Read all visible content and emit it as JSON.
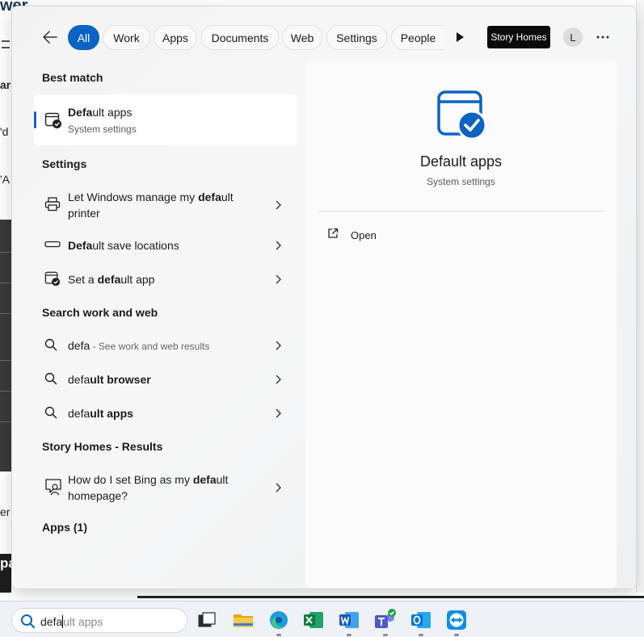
{
  "background_window": {
    "fragments": [
      "wer",
      "arc",
      "'d",
      "'A",
      "er",
      "pat"
    ]
  },
  "filters": {
    "back_label": "Back",
    "tabs": [
      {
        "label": "All",
        "active": true
      },
      {
        "label": "Work",
        "active": false
      },
      {
        "label": "Apps",
        "active": false
      },
      {
        "label": "Documents",
        "active": false
      },
      {
        "label": "Web",
        "active": false
      },
      {
        "label": "Settings",
        "active": false
      },
      {
        "label": "People",
        "active": false
      }
    ],
    "org_badge": "Story Homes",
    "avatar_initial": "L"
  },
  "results": {
    "best_match_heading": "Best match",
    "best_match": {
      "title_bold": "Defa",
      "title_rest": "ult apps",
      "subtitle": "System settings"
    },
    "settings_heading": "Settings",
    "settings_items": [
      {
        "pre": "Let Windows manage my ",
        "bold": "defa",
        "post": "ult printer"
      },
      {
        "pre": "",
        "bold": "Defa",
        "post": "ult save locations"
      },
      {
        "pre": "Set a ",
        "bold": "defa",
        "post": "ult app"
      }
    ],
    "web_heading": "Search work and web",
    "web_items": [
      {
        "bold": "defa",
        "muted": " - See work and web results"
      },
      {
        "pre": "defa",
        "bold": "ult browser"
      },
      {
        "pre": "defa",
        "bold": "ult apps"
      }
    ],
    "org_heading": "Story Homes - Results",
    "org_items": [
      {
        "pre": "How do I set Bing as my ",
        "bold": "defa",
        "post": "ult homepage?"
      }
    ],
    "apps_heading": "Apps (1)"
  },
  "detail": {
    "title": "Default apps",
    "subtitle": "System settings",
    "open_label": "Open"
  },
  "taskbar": {
    "search_typed": "defa",
    "search_ghost": "ult apps",
    "apps": [
      "task-view",
      "file-explorer",
      "edge",
      "excel",
      "word",
      "teams",
      "outlook",
      "teamviewer"
    ]
  },
  "colors": {
    "accent": "#0b63c4",
    "panel_bg": "#f3f3f3",
    "badge_bg": "#0b0b0b"
  }
}
